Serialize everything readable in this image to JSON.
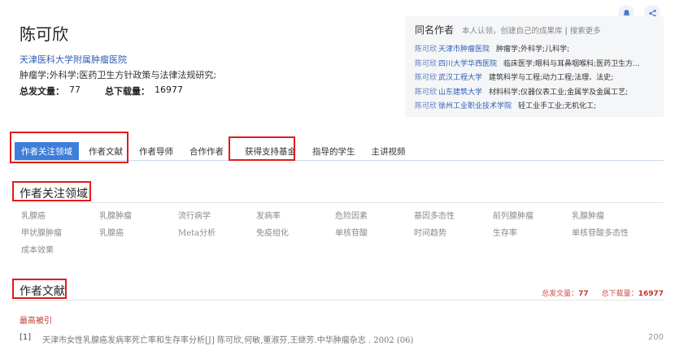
{
  "author": {
    "name": "陈可欣",
    "institution": "天津医科大学附属肿瘤医院",
    "fields": "肿瘤学;外科学;医药卫生方针政策与法律法规研究;",
    "total_pub_label": "总发文量：",
    "total_pub": "77",
    "total_dl_label": "总下载量：",
    "total_dl": "16977"
  },
  "same_name": {
    "title": "同名作者",
    "subtitle": "本人认领，创建自己的成果库",
    "sep": "|",
    "more": "搜索更多",
    "rows": [
      {
        "name": "陈可欣",
        "inst": "天津市肿瘤医院",
        "fields": "肿瘤学;外科学;儿科学;"
      },
      {
        "name": "陈可欣",
        "inst": "四川大学华西医院",
        "fields": "临床医学;眼科与耳鼻咽喉科;医药卫生方..."
      },
      {
        "name": "陈可欣",
        "inst": "武汉工程大学",
        "fields": "建筑科学与工程;动力工程;法理、法史;"
      },
      {
        "name": "陈可欣",
        "inst": "山东建筑大学",
        "fields": "材料科学;仪器仪表工业;金属学及金属工艺;"
      },
      {
        "name": "陈可欣",
        "inst": "徐州工业职业技术学院",
        "fields": "轻工业手工业;无机化工;"
      }
    ]
  },
  "tabs": [
    "作者关注领域",
    "作者文献",
    "作者导师",
    "合作作者",
    "获得支持基金",
    "指导的学生",
    "主讲视频"
  ],
  "focus": {
    "title": "作者关注领域",
    "keywords": [
      "乳腺癌",
      "乳腺肿瘤",
      "流行病学",
      "发病率",
      "危险因素",
      "基因多态性",
      "前列腺肿瘤",
      "乳腺肿瘤",
      "甲状腺肿瘤",
      "乳腺癌",
      "Meta分析",
      "免疫组化",
      "单核苷酸",
      "时间趋势",
      "生存率",
      "单核苷酸多态性",
      "成本效果"
    ]
  },
  "literature": {
    "title": "作者文献",
    "pub_label": "总发文量：",
    "pub": "77",
    "dl_label": "总下载量：",
    "dl": "16977",
    "most_cited": "最高被引",
    "refs": [
      {
        "num": "[1]",
        "text": "天津市女性乳腺癌发病率死亡率和生存率分析[J] 陈可欣,何敏,董淑芬,王继芳.中华肿瘤杂志 . 2002 (06)",
        "count": "200"
      }
    ]
  },
  "icons": {
    "bell": "bell-icon",
    "share": "share-icon"
  },
  "colors": {
    "accent": "#3d7ed8",
    "highlight": "#e11b1b",
    "link": "#2f5fb3"
  }
}
